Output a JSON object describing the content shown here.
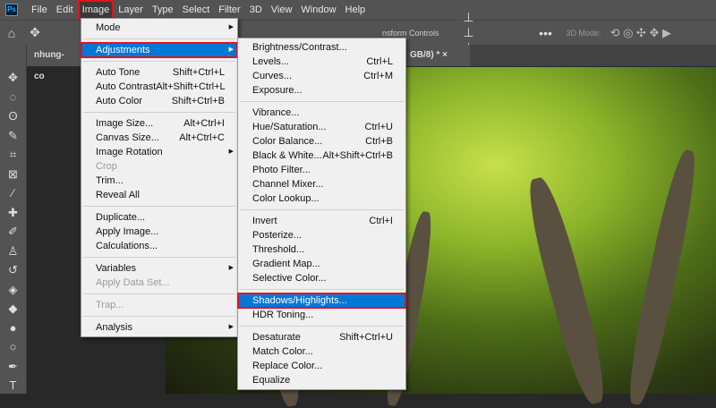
{
  "menubar": {
    "logo": "Ps",
    "items": [
      "File",
      "Edit",
      "Image",
      "Layer",
      "Type",
      "Select",
      "Filter",
      "3D",
      "View",
      "Window",
      "Help"
    ],
    "active": "Image"
  },
  "options": {
    "transform_label": "nsform Controls",
    "mode_label": "3D Mode:"
  },
  "tabs": [
    {
      "label": "nhung-co"
    },
    {
      "label": "GB/8) *",
      "close": "×"
    }
  ],
  "image_menu": [
    {
      "label": "Mode",
      "submenu": true
    },
    {
      "sep": true
    },
    {
      "label": "Adjustments",
      "submenu": true,
      "selected": true
    },
    {
      "sep": true
    },
    {
      "label": "Auto Tone",
      "shortcut": "Shift+Ctrl+L"
    },
    {
      "label": "Auto Contrast",
      "shortcut": "Alt+Shift+Ctrl+L"
    },
    {
      "label": "Auto Color",
      "shortcut": "Shift+Ctrl+B"
    },
    {
      "sep": true
    },
    {
      "label": "Image Size...",
      "shortcut": "Alt+Ctrl+I"
    },
    {
      "label": "Canvas Size...",
      "shortcut": "Alt+Ctrl+C"
    },
    {
      "label": "Image Rotation",
      "submenu": true
    },
    {
      "label": "Crop",
      "disabled": true
    },
    {
      "label": "Trim..."
    },
    {
      "label": "Reveal All"
    },
    {
      "sep": true
    },
    {
      "label": "Duplicate..."
    },
    {
      "label": "Apply Image..."
    },
    {
      "label": "Calculations..."
    },
    {
      "sep": true
    },
    {
      "label": "Variables",
      "submenu": true
    },
    {
      "label": "Apply Data Set...",
      "disabled": true
    },
    {
      "sep": true
    },
    {
      "label": "Trap...",
      "disabled": true
    },
    {
      "sep": true
    },
    {
      "label": "Analysis",
      "submenu": true
    }
  ],
  "adjust_menu": [
    {
      "label": "Brightness/Contrast..."
    },
    {
      "label": "Levels...",
      "shortcut": "Ctrl+L"
    },
    {
      "label": "Curves...",
      "shortcut": "Ctrl+M"
    },
    {
      "label": "Exposure..."
    },
    {
      "sep": true
    },
    {
      "label": "Vibrance..."
    },
    {
      "label": "Hue/Saturation...",
      "shortcut": "Ctrl+U"
    },
    {
      "label": "Color Balance...",
      "shortcut": "Ctrl+B"
    },
    {
      "label": "Black & White...",
      "shortcut": "Alt+Shift+Ctrl+B"
    },
    {
      "label": "Photo Filter..."
    },
    {
      "label": "Channel Mixer..."
    },
    {
      "label": "Color Lookup..."
    },
    {
      "sep": true
    },
    {
      "label": "Invert",
      "shortcut": "Ctrl+I"
    },
    {
      "label": "Posterize..."
    },
    {
      "label": "Threshold..."
    },
    {
      "label": "Gradient Map..."
    },
    {
      "label": "Selective Color..."
    },
    {
      "sep": true
    },
    {
      "label": "Shadows/Highlights...",
      "selected": true
    },
    {
      "label": "HDR Toning..."
    },
    {
      "sep": true
    },
    {
      "label": "Desaturate",
      "shortcut": "Shift+Ctrl+U"
    },
    {
      "label": "Match Color..."
    },
    {
      "label": "Replace Color..."
    },
    {
      "label": "Equalize"
    }
  ]
}
